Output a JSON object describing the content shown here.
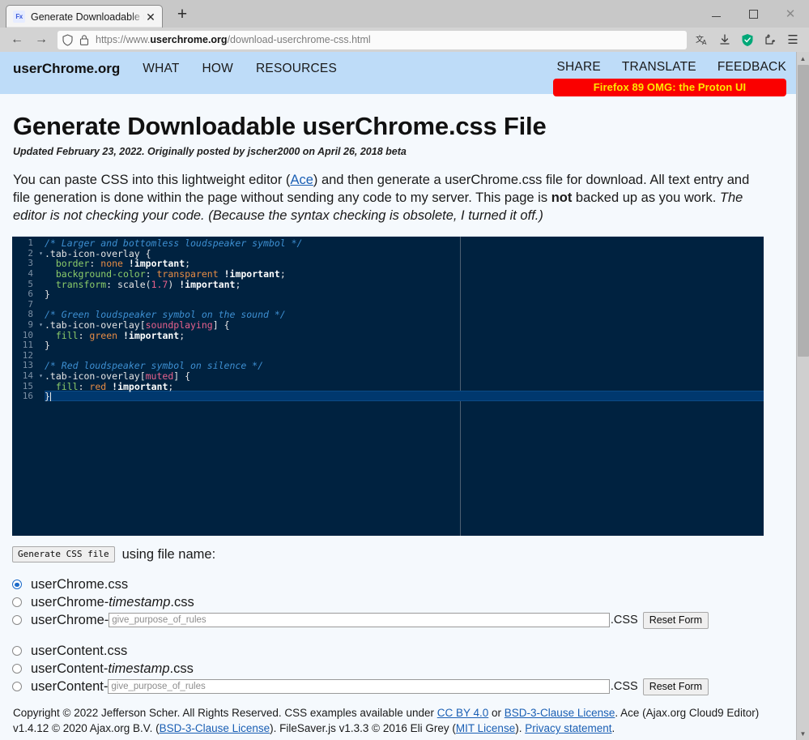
{
  "browser": {
    "tab": {
      "title": "Generate Downloadable userCh",
      "favicon_label": "Fx",
      "close_label": "✕"
    },
    "newtab_label": "+",
    "window_controls": {
      "minimize": "minimize-button",
      "maximize": "maximize-button",
      "close": "✕"
    },
    "nav": {
      "back": "←",
      "forward": "→",
      "url_scheme": "https://www.",
      "url_domain": "userchrome.org",
      "url_path": "/download-userchrome-css.html",
      "translate_icon": "translate-icon",
      "downloads_icon": "downloads-icon",
      "shield_icon": "shield-icon",
      "extension_icon": "extension-icon",
      "menu_icon": "☰"
    }
  },
  "site_header": {
    "brand": "userChrome.org",
    "nav_items": [
      "WHAT",
      "HOW",
      "RESOURCES"
    ],
    "right_items": [
      "SHARE",
      "TRANSLATE",
      "FEEDBACK"
    ],
    "banner": "Firefox 89 OMG: the Proton UI",
    "banner_bg": "#fa0000",
    "banner_color": "#ffe600",
    "header_bg": "#bedcf8"
  },
  "article": {
    "title": "Generate Downloadable userChrome.css File",
    "subtitle": "Updated February 23, 2022. Originally posted by jscher2000 on April 26, 2018 beta",
    "intro": {
      "p1": "You can paste CSS into this lightweight editor (",
      "ace_link": "Ace",
      "p2": ") and then generate a userChrome.css file for download. All text entry and file generation is done within the page without sending any code to my server. This page is ",
      "bold_not": "not",
      "p3": " backed up as you work. ",
      "italic_tail": "The editor is not checking your code. (Because the syntax checking is obsolete, I turned it off.)"
    }
  },
  "editor": {
    "theme_bg": "#002240",
    "active_line": 16,
    "cursor_line": 16,
    "lines": [
      {
        "n": 1,
        "fold": false,
        "tokens": [
          {
            "t": "comment",
            "v": "/* Larger and bottomless loudspeaker symbol */"
          }
        ]
      },
      {
        "n": 2,
        "fold": true,
        "tokens": [
          {
            "t": "selector",
            "v": ".tab-icon-overlay "
          },
          {
            "t": "brace",
            "v": "{"
          }
        ]
      },
      {
        "n": 3,
        "fold": false,
        "tokens": [
          {
            "t": "plain",
            "v": "  "
          },
          {
            "t": "prop",
            "v": "border"
          },
          {
            "t": "plain",
            "v": ": "
          },
          {
            "t": "kw",
            "v": "none"
          },
          {
            "t": "plain",
            "v": " "
          },
          {
            "t": "important",
            "v": "!important"
          },
          {
            "t": "plain",
            "v": ";"
          }
        ]
      },
      {
        "n": 4,
        "fold": false,
        "tokens": [
          {
            "t": "plain",
            "v": "  "
          },
          {
            "t": "prop",
            "v": "background-color"
          },
          {
            "t": "plain",
            "v": ": "
          },
          {
            "t": "kw",
            "v": "transparent"
          },
          {
            "t": "plain",
            "v": " "
          },
          {
            "t": "important",
            "v": "!important"
          },
          {
            "t": "plain",
            "v": ";"
          }
        ]
      },
      {
        "n": 5,
        "fold": false,
        "tokens": [
          {
            "t": "plain",
            "v": "  "
          },
          {
            "t": "prop",
            "v": "transform"
          },
          {
            "t": "plain",
            "v": ": "
          },
          {
            "t": "fn",
            "v": "scale("
          },
          {
            "t": "num",
            "v": "1.7"
          },
          {
            "t": "fn",
            "v": ")"
          },
          {
            "t": "plain",
            "v": " "
          },
          {
            "t": "important",
            "v": "!important"
          },
          {
            "t": "plain",
            "v": ";"
          }
        ]
      },
      {
        "n": 6,
        "fold": false,
        "tokens": [
          {
            "t": "brace",
            "v": "}"
          }
        ]
      },
      {
        "n": 7,
        "fold": false,
        "tokens": []
      },
      {
        "n": 8,
        "fold": false,
        "tokens": [
          {
            "t": "comment",
            "v": "/* Green loudspeaker symbol on the sound */"
          }
        ]
      },
      {
        "n": 9,
        "fold": true,
        "tokens": [
          {
            "t": "selector",
            "v": ".tab-icon-overlay["
          },
          {
            "t": "attr",
            "v": "soundplaying"
          },
          {
            "t": "selector",
            "v": "] "
          },
          {
            "t": "brace",
            "v": "{"
          }
        ]
      },
      {
        "n": 10,
        "fold": false,
        "tokens": [
          {
            "t": "plain",
            "v": "  "
          },
          {
            "t": "prop",
            "v": "fill"
          },
          {
            "t": "plain",
            "v": ": "
          },
          {
            "t": "kw",
            "v": "green"
          },
          {
            "t": "plain",
            "v": " "
          },
          {
            "t": "important",
            "v": "!important"
          },
          {
            "t": "plain",
            "v": ";"
          }
        ]
      },
      {
        "n": 11,
        "fold": false,
        "tokens": [
          {
            "t": "brace",
            "v": "}"
          }
        ]
      },
      {
        "n": 12,
        "fold": false,
        "tokens": []
      },
      {
        "n": 13,
        "fold": false,
        "tokens": [
          {
            "t": "comment",
            "v": "/* Red loudspeaker symbol on silence */"
          }
        ]
      },
      {
        "n": 14,
        "fold": true,
        "tokens": [
          {
            "t": "selector",
            "v": ".tab-icon-overlay["
          },
          {
            "t": "attr",
            "v": "muted"
          },
          {
            "t": "selector",
            "v": "] "
          },
          {
            "t": "brace",
            "v": "{"
          }
        ]
      },
      {
        "n": 15,
        "fold": false,
        "tokens": [
          {
            "t": "plain",
            "v": "  "
          },
          {
            "t": "prop",
            "v": "fill"
          },
          {
            "t": "plain",
            "v": ": "
          },
          {
            "t": "kw",
            "v": "red"
          },
          {
            "t": "plain",
            "v": " "
          },
          {
            "t": "important",
            "v": "!important"
          },
          {
            "t": "plain",
            "v": ";"
          }
        ]
      },
      {
        "n": 16,
        "fold": false,
        "tokens": [
          {
            "t": "brace",
            "v": "}"
          }
        ],
        "cursor": true
      }
    ]
  },
  "form": {
    "generate_button": "Generate CSS file",
    "using_label": "using file name:",
    "placeholder": "give_purpose_of_rules",
    "css_suffix": ".CSS",
    "reset_button": "Reset Form",
    "options": [
      {
        "id": "userchrome-plain",
        "label_pre": "userChrome.css",
        "label_em": "",
        "label_post": "",
        "selected": true,
        "has_input": false
      },
      {
        "id": "userchrome-timestamp",
        "label_pre": "userChrome-",
        "label_em": "timestamp",
        "label_post": ".css",
        "selected": false,
        "has_input": false
      },
      {
        "id": "userchrome-custom",
        "label_pre": "userChrome-",
        "label_em": "",
        "label_post": "",
        "selected": false,
        "has_input": true
      },
      {
        "id": "usercontent-plain",
        "label_pre": "userContent.css",
        "label_em": "",
        "label_post": "",
        "selected": false,
        "has_input": false
      },
      {
        "id": "usercontent-timestamp",
        "label_pre": "userContent-",
        "label_em": "timestamp",
        "label_post": ".css",
        "selected": false,
        "has_input": false
      },
      {
        "id": "usercontent-custom",
        "label_pre": "userContent-",
        "label_em": "",
        "label_post": "",
        "selected": false,
        "has_input": true
      }
    ]
  },
  "footer": {
    "s1": "Copyright © 2022 Jefferson Scher. All Rights Reserved. CSS examples available under ",
    "link_cc": "CC BY 4.0",
    "s2": " or ",
    "link_bsd1": "BSD-3-Clause License",
    "s3": ". Ace (Ajax.org Cloud9 Editor) v1.4.12 © 2020 Ajax.org B.V. (",
    "link_bsd2": "BSD-3-Clause License",
    "s4": "). FileSaver.js v1.3.3 © 2016 Eli Grey (",
    "link_mit": "MIT License",
    "s5": "). ",
    "link_privacy": "Privacy statement",
    "s6": "."
  }
}
